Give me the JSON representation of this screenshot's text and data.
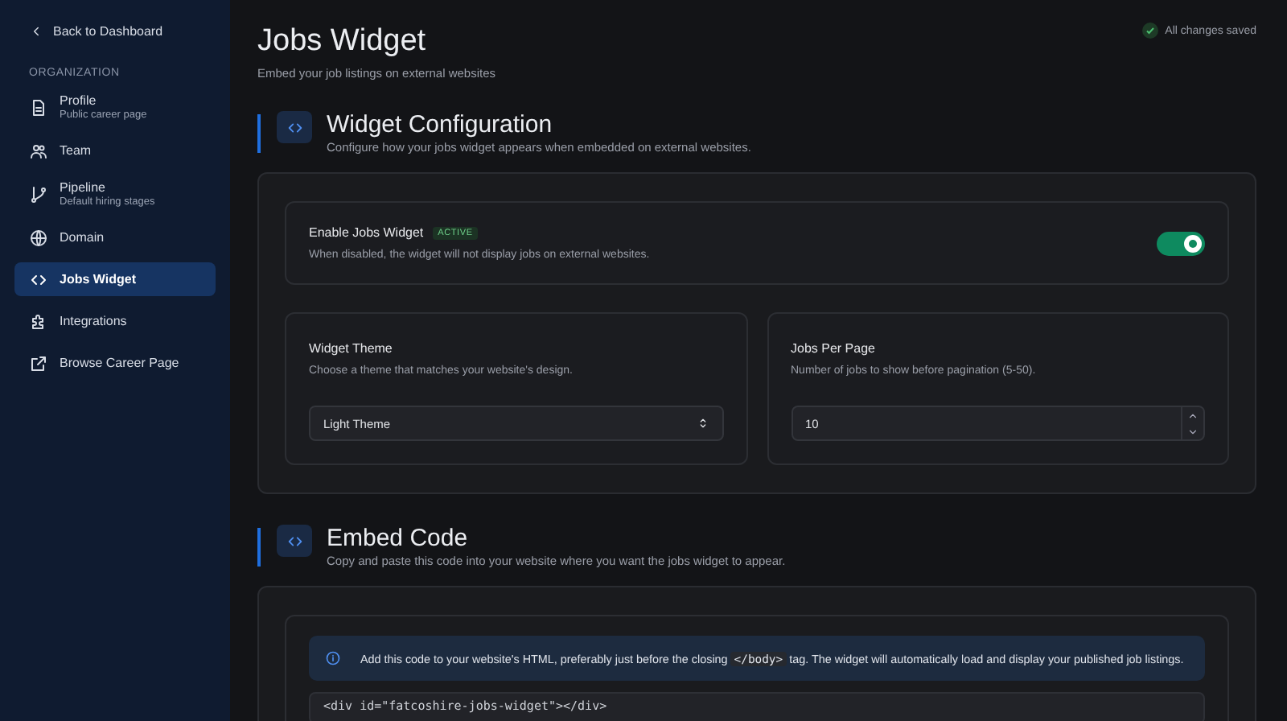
{
  "sidebar": {
    "back_link": "Back to Dashboard",
    "section_label": "ORGANIZATION",
    "items": [
      {
        "label": "Profile",
        "subtitle": "Public career page",
        "selected": false
      },
      {
        "label": "Team",
        "selected": false
      },
      {
        "label": "Pipeline",
        "subtitle": "Default hiring stages",
        "selected": false
      },
      {
        "label": "Domain",
        "selected": false
      },
      {
        "label": "Jobs Widget",
        "selected": true
      },
      {
        "label": "Integrations",
        "selected": false
      },
      {
        "label": "Browse Career Page",
        "selected": false
      }
    ]
  },
  "header": {
    "title": "Jobs Widget",
    "subtitle": "Embed your job listings on external websites",
    "status": "All changes saved"
  },
  "configuration": {
    "title": "Widget Configuration",
    "description": "Configure how your jobs widget appears when embedded on external websites.",
    "enable": {
      "label": "Enable Jobs Widget",
      "badge": "ACTIVE",
      "description": "When disabled, the widget will not display jobs on external websites.",
      "on": true
    },
    "theme": {
      "label": "Widget Theme",
      "description": "Choose a theme that matches your website's design.",
      "value": "Light Theme"
    },
    "jobs_per_page": {
      "label": "Jobs Per Page",
      "description": "Number of jobs to show before pagination (5-50).",
      "value": "10"
    }
  },
  "embed": {
    "title": "Embed Code",
    "description": "Copy and paste this code into your website where you want the jobs widget to appear.",
    "info": "Add this code to your website's HTML, preferably just before the closing **</body>** tag. The widget will automatically load and display your published job listings.",
    "code": "<div id=\"fatcoshire-jobs-widget\"></div>"
  }
}
